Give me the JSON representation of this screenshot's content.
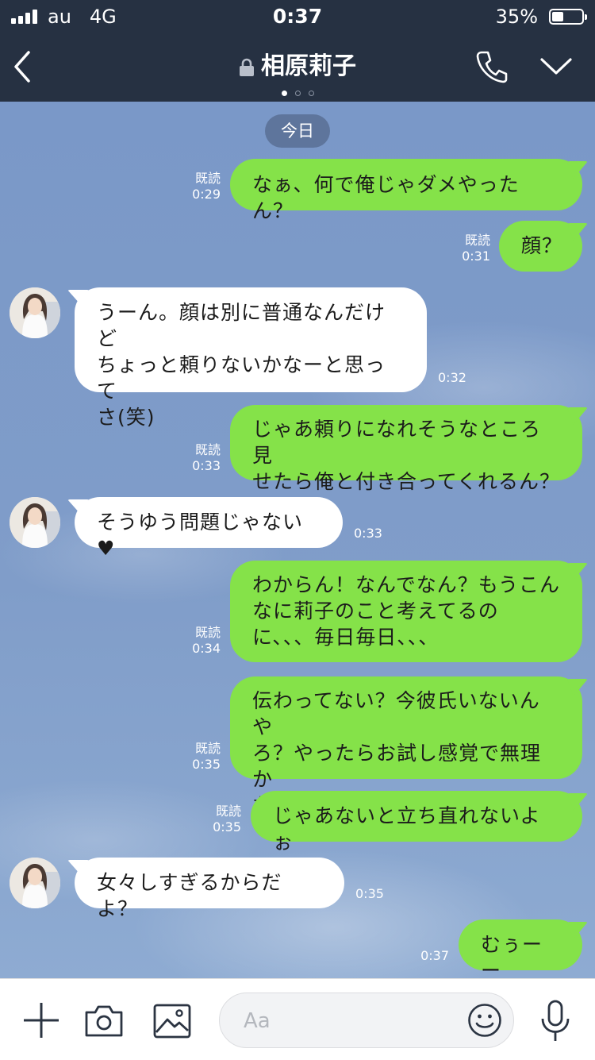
{
  "status_bar": {
    "carrier": "au",
    "network": "4G",
    "time": "0:37",
    "battery": "35%",
    "battery_level": 0.35
  },
  "header": {
    "title": "相原莉子",
    "page_dots": 3,
    "active_dot": 0
  },
  "date_chip": "今日",
  "messages": [
    {
      "side": "out",
      "text": "なぁ、何で俺じゃダメやったん？",
      "read": "既読",
      "time": "0:29"
    },
    {
      "side": "out",
      "text": "顔？",
      "read": "既読",
      "time": "0:31"
    },
    {
      "side": "in",
      "text": "うーん。顔は別に普通なんだけど\nちょっと頼りないかなーと思って\nさ(笑)",
      "time": "0:32"
    },
    {
      "side": "out",
      "text": "じゃあ頼りになれそうなところ見\nせたら俺と付き合ってくれるん？",
      "read": "既読",
      "time": "0:33"
    },
    {
      "side": "in",
      "text": "そうゆう問題じゃない",
      "emoji": "♥",
      "time": "0:33"
    },
    {
      "side": "out",
      "text": "わからん！なんでなん？もうこん\nなに莉子のこと考えてるの\nに、、、毎日毎日、、、",
      "read": "既読",
      "time": "0:34"
    },
    {
      "side": "out",
      "text": "伝わってない？今彼氏いないんや\nろ？やったらお試し感覚で無理か\nな？ほんまに後悔させへんから",
      "read": "既読",
      "time": "0:35"
    },
    {
      "side": "out",
      "text": "じゃあないと立ち直れないよぉ",
      "read": "既読",
      "time": "0:35"
    },
    {
      "side": "in",
      "text": "女々しすぎるからだよ？",
      "time": "0:35"
    },
    {
      "side": "out",
      "text": "むぅーー",
      "time": "0:37"
    }
  ],
  "input": {
    "placeholder": "Aa"
  },
  "icons": {
    "back": "chevron-left-icon",
    "lock": "lock-icon",
    "call": "phone-icon",
    "menu": "chevron-down-icon",
    "plus": "plus-icon",
    "camera": "camera-icon",
    "image": "image-icon",
    "emoji": "smiley-icon",
    "mic": "microphone-icon"
  },
  "colors": {
    "header": "#263142",
    "outgoing": "#85e249",
    "incoming": "#ffffff",
    "chip": "#5e759c"
  }
}
